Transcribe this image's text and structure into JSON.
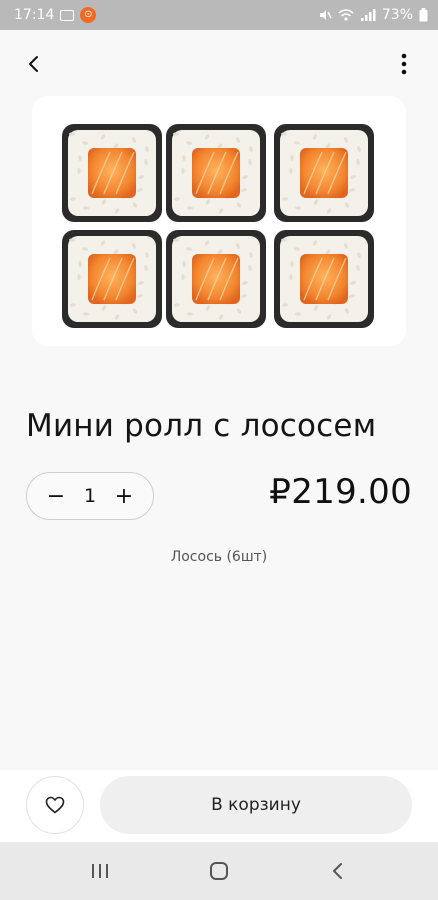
{
  "status_bar": {
    "time": "17:14",
    "badge": "⊙",
    "battery": "73%"
  },
  "top_bar": {
    "back_icon": "chevron-left-icon",
    "menu_icon": "more-vertical-icon"
  },
  "product": {
    "image_icon": "salmon-maki-roll-image",
    "title": "Мини ролл с лососем",
    "price": "₽219.00",
    "description": "Лосось (6шт)",
    "quantity": "1",
    "minus_label": "−",
    "plus_label": "+"
  },
  "actions": {
    "favorite_icon": "heart-icon",
    "cart_label": "В корзину"
  },
  "nav_bar": {
    "recents_icon": "recents-icon",
    "home_icon": "home-icon",
    "back_icon": "back-icon"
  },
  "colors": {
    "status_bar_bg": "#b9b9b9",
    "page_bg": "#f8f8f8",
    "cart_button_bg": "#efefef",
    "salmon": "#f28a3a",
    "nori": "#2b2b2b"
  }
}
